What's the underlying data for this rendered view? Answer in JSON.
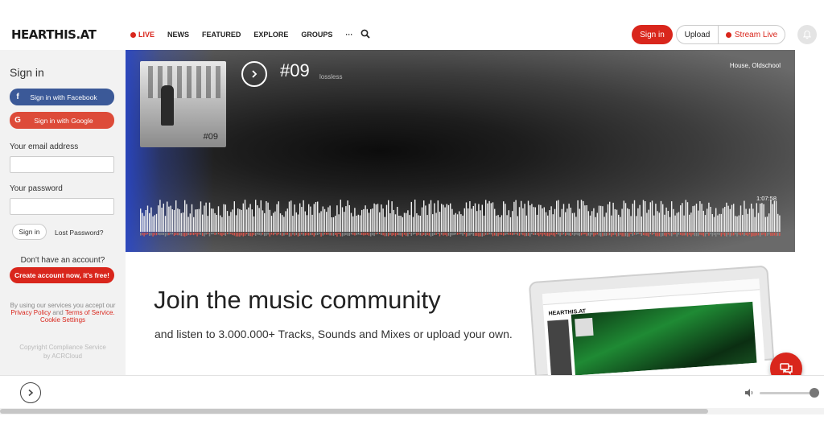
{
  "header": {
    "logo": "HEARTHIS.AT",
    "nav": [
      {
        "label": "LIVE"
      },
      {
        "label": "NEWS"
      },
      {
        "label": "FEATURED"
      },
      {
        "label": "EXPLORE"
      },
      {
        "label": "GROUPS"
      },
      {
        "label": "···"
      }
    ],
    "signin_label": "Sign in",
    "upload_label": "Upload",
    "stream_label": "Stream Live"
  },
  "sidebar": {
    "title": "Sign in",
    "facebook_label": "Sign in with Facebook",
    "google_label": "Sign in with Google",
    "email_label": "Your email address",
    "email_value": "",
    "password_label": "Your password",
    "password_value": "",
    "signin_label": "Sign in",
    "lost_password": "Lost Password?",
    "no_account": "Don't have an account?",
    "create_label": "Create account now, it's free!",
    "terms_prefix": "By using our services you accept our",
    "privacy_link": "Privacy Policy",
    "and_text": "and",
    "terms_link": "Terms of Service",
    "cookie_link": "Cookie Settings",
    "copyright_line1": "Copyright Compliance Service",
    "copyright_line2": "by ACRCloud"
  },
  "hero": {
    "cover_number": "#09",
    "title": "#09",
    "quality": "lossless",
    "genre": "House, Oldschool",
    "duration": "1:07:58"
  },
  "join": {
    "title": "Join the music community",
    "subtitle": "and listen to 3.000.000+ Tracks, Sounds and Mixes or upload your own."
  },
  "laptop": {
    "logo": "HEARTHIS.AT"
  },
  "colors": {
    "accent": "#d9261c",
    "facebook": "#3b5998",
    "google": "#dd4b39"
  },
  "icons": [
    "search-icon",
    "bell-icon",
    "play-icon",
    "chat-icon",
    "volume-icon",
    "facebook-icon",
    "google-icon"
  ]
}
